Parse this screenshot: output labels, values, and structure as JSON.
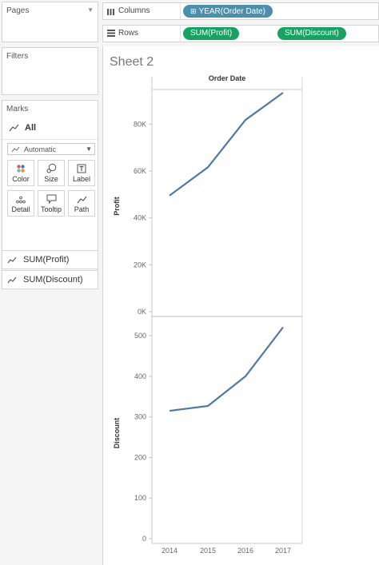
{
  "left_panel": {
    "pages_title": "Pages",
    "filters_title": "Filters",
    "marks": {
      "title": "Marks",
      "all_label": "All",
      "mark_type": "Automatic",
      "buttons": [
        {
          "label": "Color",
          "icon": "color-icon"
        },
        {
          "label": "Size",
          "icon": "size-icon"
        },
        {
          "label": "Label",
          "icon": "label-icon"
        },
        {
          "label": "Detail",
          "icon": "detail-icon"
        },
        {
          "label": "Tooltip",
          "icon": "tooltip-icon"
        },
        {
          "label": "Path",
          "icon": "path-icon"
        }
      ],
      "measure_cards": [
        "SUM(Profit)",
        "SUM(Discount)"
      ]
    }
  },
  "shelves": {
    "columns_label": "Columns",
    "rows_label": "Rows",
    "columns_pills": [
      "YEAR(Order Date)"
    ],
    "rows_pills": [
      "SUM(Profit)",
      "SUM(Discount)"
    ]
  },
  "sheet": {
    "title": "Sheet 2",
    "header": "Order Date"
  },
  "colors": {
    "line": "#4e79a7",
    "pill_dimension": "#4a8fad",
    "pill_measure": "#16a362"
  },
  "chart_data": [
    {
      "type": "line",
      "x": [
        "2014",
        "2015",
        "2016",
        "2017"
      ],
      "xlabel": "Order Date",
      "ylabel": "Profit",
      "y_ticks": [
        "0K",
        "20K",
        "40K",
        "60K",
        "80K"
      ],
      "ylim": [
        0,
        90000
      ],
      "series": [
        {
          "values": [
            49500,
            61600,
            81800,
            93400
          ]
        }
      ]
    },
    {
      "type": "line",
      "x": [
        "2014",
        "2015",
        "2016",
        "2017"
      ],
      "xlabel": "Order Date",
      "ylabel": "Discount",
      "y_ticks": [
        "0",
        "100",
        "200",
        "300",
        "400",
        "500"
      ],
      "ylim": [
        0,
        520
      ],
      "series": [
        {
          "values": [
            315,
            327,
            400,
            521
          ]
        }
      ]
    }
  ]
}
